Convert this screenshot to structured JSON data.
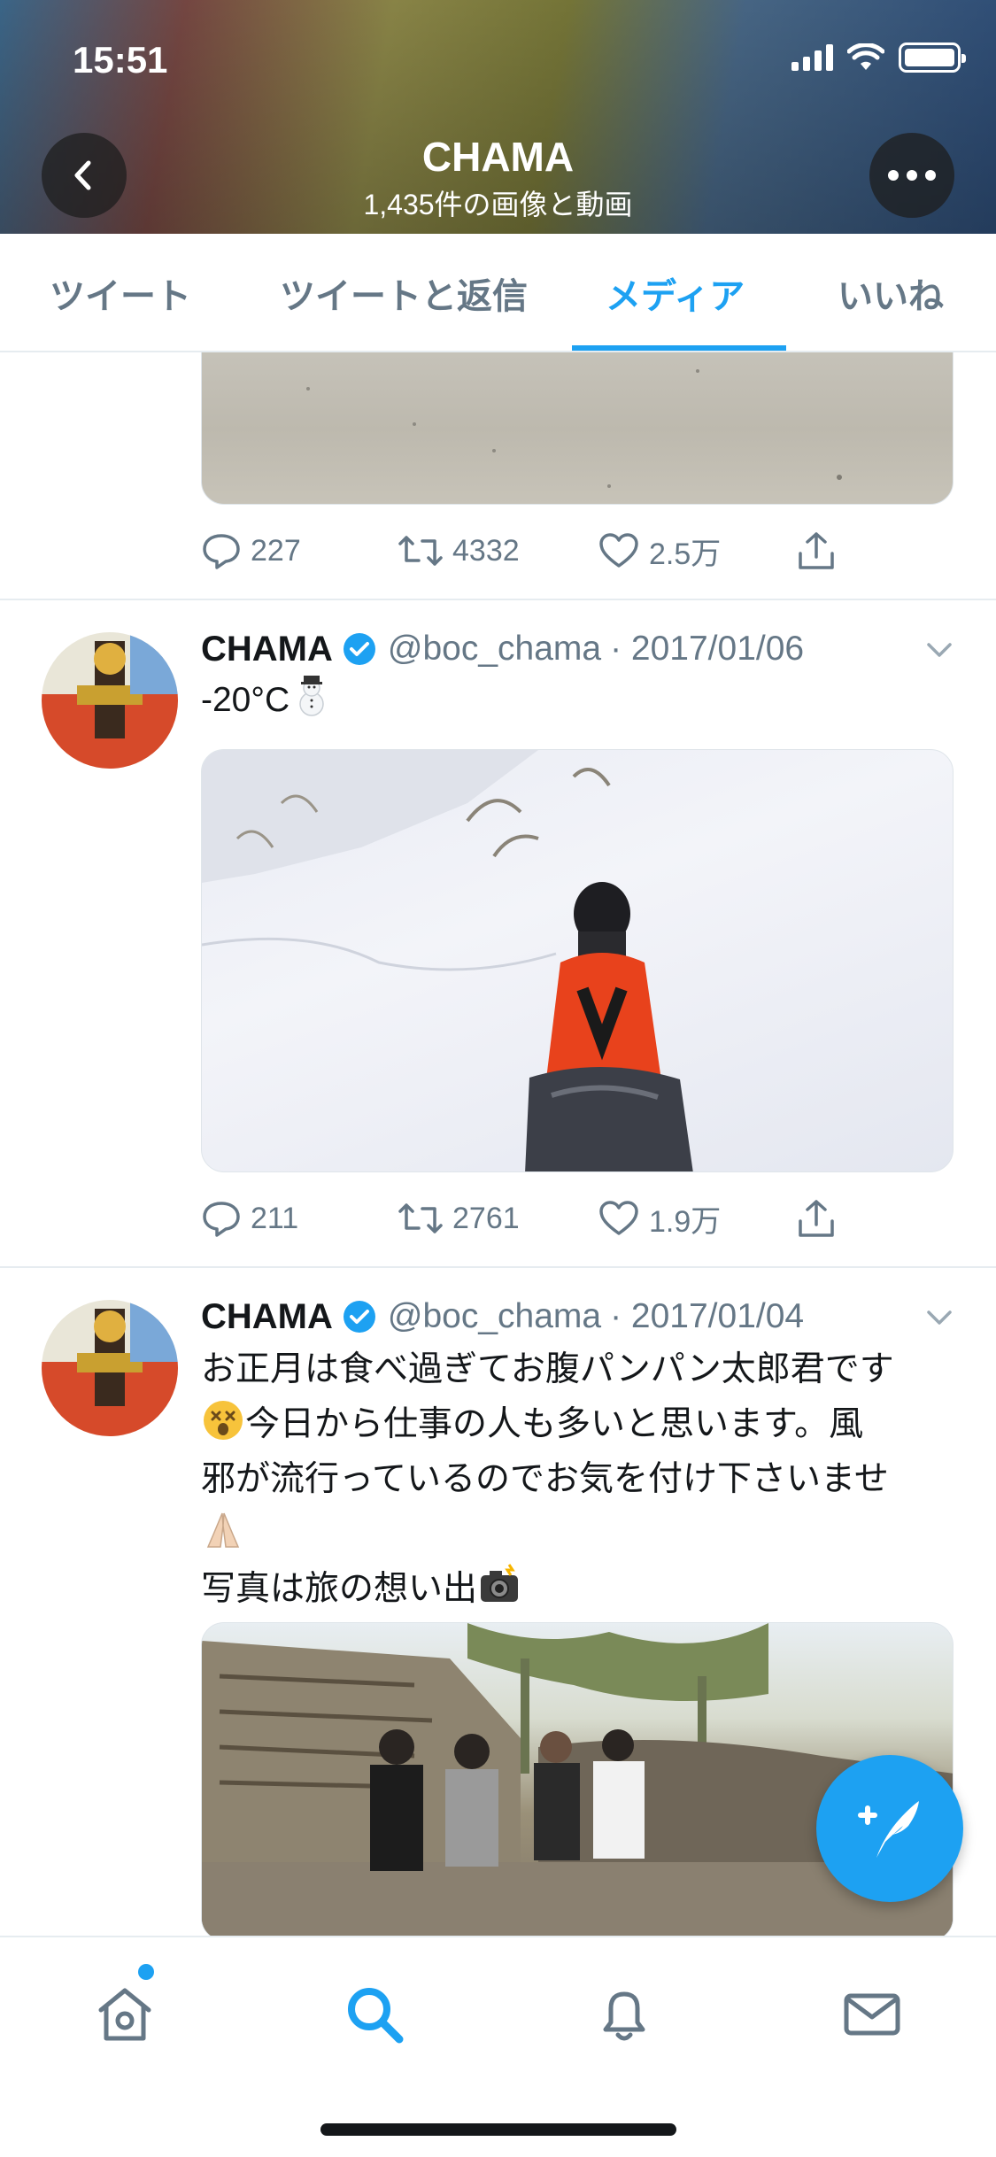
{
  "status_bar": {
    "time": "15:51"
  },
  "header": {
    "title": "CHAMA",
    "subtitle": "1,435件の画像と動画"
  },
  "tabs": [
    {
      "label": "ツイート"
    },
    {
      "label": "ツイートと返信"
    },
    {
      "label": "メディア",
      "active": true
    },
    {
      "label": "いいね"
    }
  ],
  "first_tweet_actions": {
    "replies": "227",
    "retweets": "4332",
    "likes": "2.5万"
  },
  "tweets": [
    {
      "name": "CHAMA",
      "handle": "@boc_chama",
      "date": "· 2017/01/06",
      "text": "-20°C",
      "replies": "211",
      "retweets": "2761",
      "likes": "1.9万"
    },
    {
      "name": "CHAMA",
      "handle": "@boc_chama",
      "date": "· 2017/01/04",
      "text_line1": "お正月は食べ過ぎてお腹パンパン太郎君です",
      "text_line2": "今日から仕事の人も多いと思います。風",
      "text_line3": "邪が流行っているのでお気を付け下さいませ",
      "text_line5": "写真は旅の想い出"
    }
  ],
  "colors": {
    "accent": "#1da1f2",
    "muted": "#657786",
    "text": "#14171a"
  }
}
